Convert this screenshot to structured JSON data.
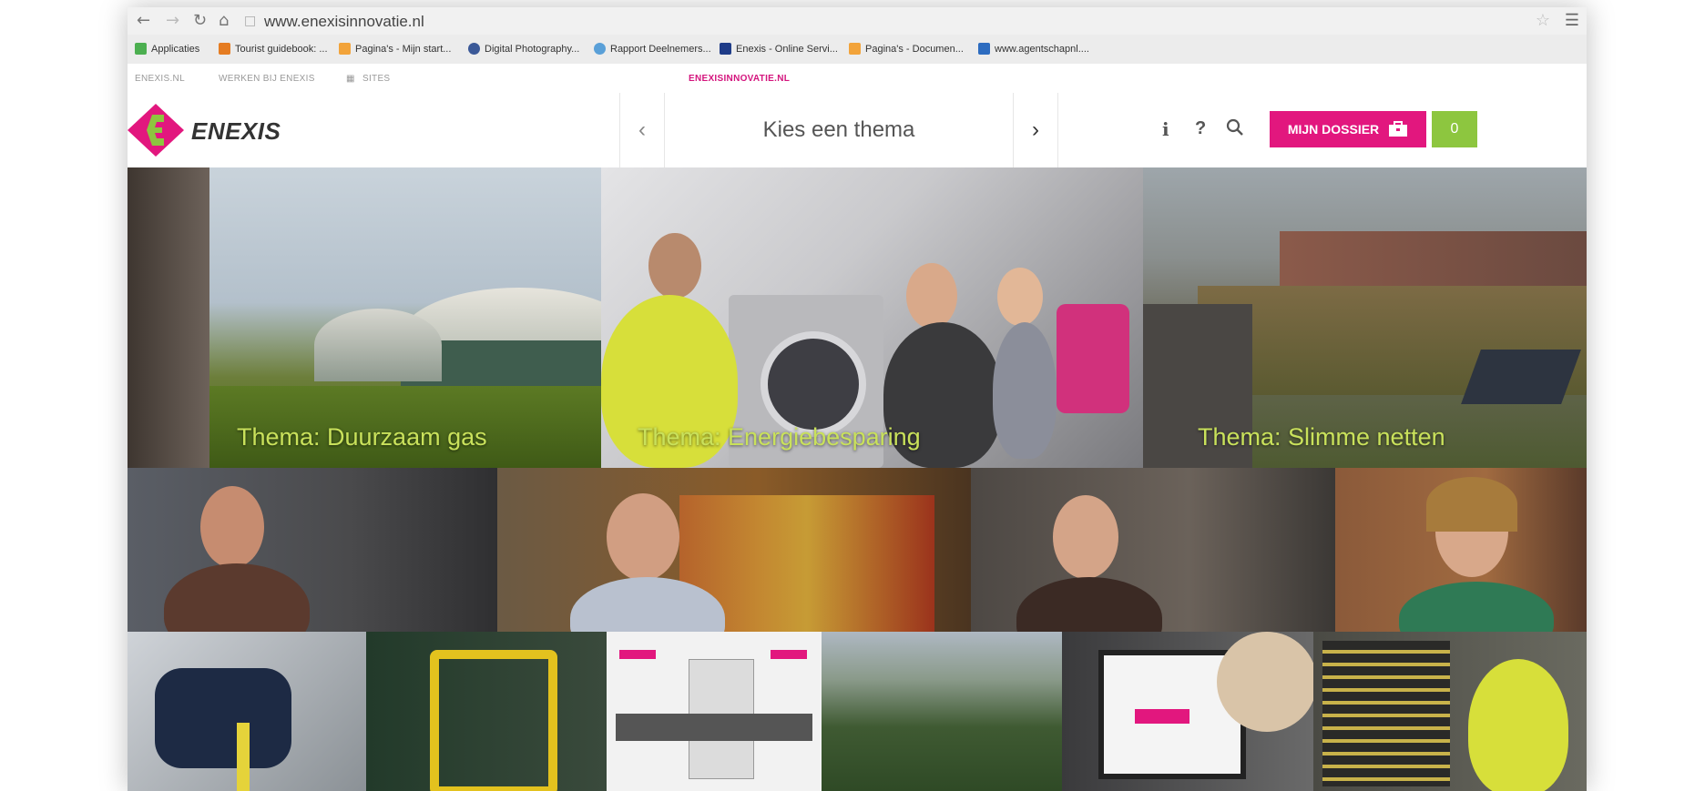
{
  "browser": {
    "url": "www.enexisinnovatie.nl",
    "bookmarks": [
      {
        "label": "Applicaties",
        "color": "#4caf50"
      },
      {
        "label": "Tourist guidebook: ...",
        "color": "#e57c22"
      },
      {
        "label": "Pagina's - Mijn start...",
        "color": "#f2a33a"
      },
      {
        "label": "Digital Photography...",
        "color": "#3b5998"
      },
      {
        "label": "Rapport Deelnemers...",
        "color": "#5aa0d8"
      },
      {
        "label": "Enexis - Online Servi...",
        "color": "#1f3c88"
      },
      {
        "label": "Pagina's - Documen...",
        "color": "#f2a33a"
      },
      {
        "label": "www.agentschapnl....",
        "color": "#2d6cc0"
      }
    ]
  },
  "topstrip": {
    "link1": "ENEXIS.NL",
    "link2": "WERKEN BIJ ENEXIS",
    "link3": "SITES",
    "center": "ENEXISINNOVATIE.NL"
  },
  "header": {
    "logo_text": "ENEXIS",
    "theme_label": "Kies een thema",
    "dossier_label": "MIJN DOSSIER",
    "dossier_count": "0"
  },
  "themes": [
    {
      "caption": "Thema: Duurzaam gas"
    },
    {
      "caption": "Thema: Energiebesparing"
    },
    {
      "caption": "Thema: Slimme netten"
    }
  ],
  "colors": {
    "brand_magenta": "#e2177e",
    "brand_green": "#8dc63f",
    "caption_green": "#c9e15b"
  }
}
